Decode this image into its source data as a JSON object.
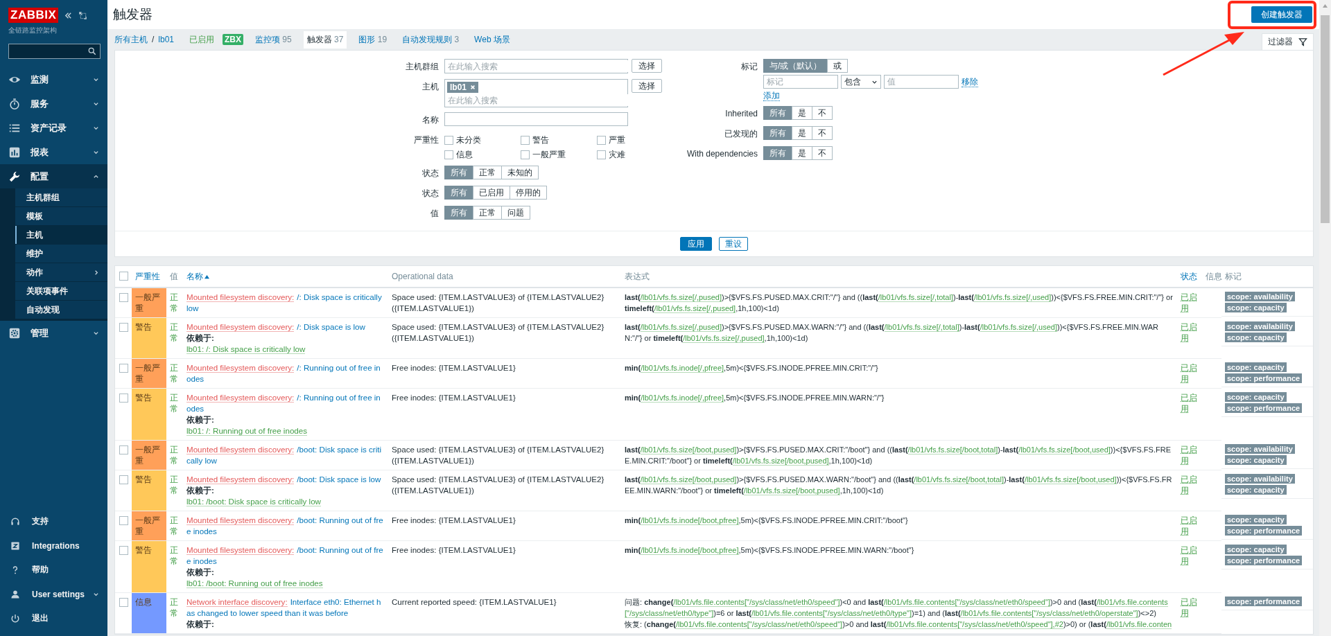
{
  "sidebar": {
    "logo": "ZABBIX",
    "subtitle": "全链路监控架构",
    "menu": [
      {
        "label": "监测",
        "expanded": false
      },
      {
        "label": "服务",
        "expanded": false
      },
      {
        "label": "资产记录",
        "expanded": false
      },
      {
        "label": "报表",
        "expanded": false
      },
      {
        "label": "配置",
        "expanded": true,
        "children": [
          {
            "label": "主机群组",
            "selected": false,
            "submenu": false
          },
          {
            "label": "模板",
            "selected": false,
            "submenu": false
          },
          {
            "label": "主机",
            "selected": true,
            "submenu": false
          },
          {
            "label": "维护",
            "selected": false,
            "submenu": false
          },
          {
            "label": "动作",
            "selected": false,
            "submenu": true
          },
          {
            "label": "关联项事件",
            "selected": false,
            "submenu": false
          },
          {
            "label": "自动发现",
            "selected": false,
            "submenu": false
          }
        ]
      },
      {
        "label": "管理",
        "expanded": false
      }
    ],
    "bottom_menu": [
      {
        "label": "支持",
        "submenu": false
      },
      {
        "label": "Integrations",
        "submenu": false
      },
      {
        "label": "帮助",
        "submenu": false
      },
      {
        "label": "User settings",
        "submenu": true
      },
      {
        "label": "退出",
        "submenu": false
      }
    ]
  },
  "header": {
    "title": "触发器",
    "create_button": "创建触发器"
  },
  "nav": [
    {
      "kind": "link",
      "text": "所有主机"
    },
    {
      "kind": "sep",
      "text": "/"
    },
    {
      "kind": "link",
      "text": "lb01"
    },
    {
      "kind": "status",
      "text": "已启用"
    },
    {
      "kind": "badge",
      "text": "ZBX"
    },
    {
      "kind": "tab",
      "text": "监控项",
      "count": "95",
      "selected": false
    },
    {
      "kind": "tab",
      "text": "触发器",
      "count": "37",
      "selected": true
    },
    {
      "kind": "tab",
      "text": "图形",
      "count": "19",
      "selected": false
    },
    {
      "kind": "tab",
      "text": "自动发现规则",
      "count": "3",
      "selected": false
    },
    {
      "kind": "tab",
      "text": "Web 场景",
      "selected": false
    }
  ],
  "filter": {
    "tab": "过滤器",
    "left": [
      {
        "kind": "multiselect",
        "label": "主机群组",
        "placeholder": "在此输入搜索",
        "button": "选择"
      },
      {
        "kind": "multiselect",
        "label": "主机",
        "chips": [
          "lb01"
        ],
        "placeholder": "在此输入搜索",
        "button": "选择"
      },
      {
        "kind": "text",
        "label": "名称"
      },
      {
        "kind": "checkboxes",
        "label": "严重性",
        "options": [
          {
            "label": "未分类",
            "checked": false
          },
          {
            "label": "警告",
            "checked": false
          },
          {
            "label": "严重",
            "checked": false
          },
          {
            "label": "信息",
            "checked": false
          },
          {
            "label": "一般严重",
            "checked": false
          },
          {
            "label": "灾难",
            "checked": false
          }
        ]
      },
      {
        "kind": "segmented",
        "label": "状态",
        "options": [
          {
            "label": "所有",
            "selected": true
          },
          {
            "label": "正常",
            "selected": false
          },
          {
            "label": "未知的",
            "selected": false
          }
        ]
      },
      {
        "kind": "segmented",
        "label": "状态",
        "options": [
          {
            "label": "所有",
            "selected": true
          },
          {
            "label": "已启用",
            "selected": false
          },
          {
            "label": "停用的",
            "selected": false
          }
        ]
      },
      {
        "kind": "segmented",
        "label": "值",
        "options": [
          {
            "label": "所有",
            "selected": true
          },
          {
            "label": "正常",
            "selected": false
          },
          {
            "label": "问题",
            "selected": false
          }
        ]
      }
    ],
    "right": [
      {
        "kind": "tags",
        "label": "标记",
        "options": [
          {
            "label": "与/或（默认）",
            "selected": true
          },
          {
            "label": "或",
            "selected": false
          }
        ],
        "rows": [
          {
            "tag_placeholder": "标记",
            "operator": "包含",
            "value_placeholder": "值",
            "remove": "移除"
          }
        ],
        "add": "添加"
      },
      {
        "kind": "segmented",
        "label": "Inherited",
        "options": [
          {
            "label": "所有",
            "selected": true
          },
          {
            "label": "是",
            "selected": false
          },
          {
            "label": "不",
            "selected": false
          }
        ]
      },
      {
        "kind": "segmented",
        "label": "已发现的",
        "options": [
          {
            "label": "所有",
            "selected": true
          },
          {
            "label": "是",
            "selected": false
          },
          {
            "label": "不",
            "selected": false
          }
        ]
      },
      {
        "kind": "segmented",
        "label": "With dependencies",
        "options": [
          {
            "label": "所有",
            "selected": true
          },
          {
            "label": "是",
            "selected": false
          },
          {
            "label": "不",
            "selected": false
          }
        ]
      }
    ],
    "apply": "应用",
    "reset": "重设"
  },
  "table": {
    "select_all": {
      "checked": false
    },
    "columns": [
      {
        "label": "严重性",
        "sortable": true,
        "sorted": false
      },
      {
        "label": "值",
        "sortable": false
      },
      {
        "label": "名称",
        "sortable": true,
        "sorted": true
      },
      {
        "label": "Operational data",
        "sortable": false
      },
      {
        "label": "表达式",
        "sortable": false
      },
      {
        "label": "状态",
        "sortable": true,
        "sorted": false
      },
      {
        "label": "信息",
        "sortable": false
      },
      {
        "label": "标记",
        "sortable": false
      }
    ],
    "rows": [
      {
        "checked": false,
        "severity": "一般严重",
        "color": "#ffa059",
        "value": "正常",
        "name_prefix": "Mounted filesystem discovery:",
        "name": "/: Disk space is critically low",
        "opdata": "Space used: {ITEM.LASTVALUE3} of {ITEM.LASTVALUE2} ({ITEM.LASTVALUE1})",
        "expression": [
          [
            {
              "kind": "fn",
              "text": "last("
            },
            {
              "kind": "item",
              "text": "/lb01/vfs.fs.size[/,pused]"
            },
            {
              "kind": "plain",
              "text": ")>{$VFS.FS.PUSED.MAX.CRIT:\"/\"} and (("
            },
            {
              "kind": "fn",
              "text": "last("
            },
            {
              "kind": "item",
              "text": "/lb01/vfs.fs.size[/,total]"
            },
            {
              "kind": "plain",
              "text": ")-"
            },
            {
              "kind": "fn",
              "text": "last("
            },
            {
              "kind": "item",
              "text": "/lb01/vfs.fs.size[/,used]"
            },
            {
              "kind": "plain",
              "text": "))<{$VFS.FS.FREE.MIN.CRIT:\"/\"} or "
            },
            {
              "kind": "fn",
              "text": "timeleft("
            },
            {
              "kind": "item",
              "text": "/lb01/vfs.fs.size[/,pused]"
            },
            {
              "kind": "plain",
              "text": ",1h,100)<1d)"
            }
          ]
        ],
        "status": "已启用",
        "tags": [
          "scope: availability",
          "scope: capacity"
        ]
      },
      {
        "checked": false,
        "severity": "警告",
        "color": "#ffc859",
        "value": "正常",
        "name_prefix": "Mounted filesystem discovery:",
        "name": "/: Disk space is low",
        "depends_label": "依赖于:",
        "depends": "lb01: /: Disk space is critically low",
        "opdata": "Space used: {ITEM.LASTVALUE3} of {ITEM.LASTVALUE2} ({ITEM.LASTVALUE1})",
        "expression": [
          [
            {
              "kind": "fn",
              "text": "last("
            },
            {
              "kind": "item",
              "text": "/lb01/vfs.fs.size[/,pused]"
            },
            {
              "kind": "plain",
              "text": ")>{$VFS.FS.PUSED.MAX.WARN:\"/\"} and (("
            },
            {
              "kind": "fn",
              "text": "last("
            },
            {
              "kind": "item",
              "text": "/lb01/vfs.fs.size[/,total]"
            },
            {
              "kind": "plain",
              "text": ")-"
            },
            {
              "kind": "fn",
              "text": "last("
            },
            {
              "kind": "item",
              "text": "/lb01/vfs.fs.size[/,used]"
            },
            {
              "kind": "plain",
              "text": "))<{$VFS.FS.FREE.MIN.WARN:\"/\"} or "
            },
            {
              "kind": "fn",
              "text": "timeleft("
            },
            {
              "kind": "item",
              "text": "/lb01/vfs.fs.size[/,pused]"
            },
            {
              "kind": "plain",
              "text": ",1h,100)<1d)"
            }
          ]
        ],
        "status": "已启用",
        "tags": [
          "scope: availability",
          "scope: capacity"
        ]
      },
      {
        "checked": false,
        "severity": "一般严重",
        "color": "#ffa059",
        "value": "正常",
        "name_prefix": "Mounted filesystem discovery:",
        "name": "/: Running out of free inodes",
        "opdata": "Free inodes: {ITEM.LASTVALUE1}",
        "expression": [
          [
            {
              "kind": "fn",
              "text": "min("
            },
            {
              "kind": "item",
              "text": "/lb01/vfs.fs.inode[/,pfree]"
            },
            {
              "kind": "plain",
              "text": ",5m)<{$VFS.FS.INODE.PFREE.MIN.CRIT:\"/\"}"
            }
          ]
        ],
        "status": "已启用",
        "tags": [
          "scope: capacity",
          "scope: performance"
        ]
      },
      {
        "checked": false,
        "severity": "警告",
        "color": "#ffc859",
        "value": "正常",
        "name_prefix": "Mounted filesystem discovery:",
        "name": "/: Running out of free inodes",
        "depends_label": "依赖于:",
        "depends": "lb01: /: Running out of free inodes",
        "opdata": "Free inodes: {ITEM.LASTVALUE1}",
        "expression": [
          [
            {
              "kind": "fn",
              "text": "min("
            },
            {
              "kind": "item",
              "text": "/lb01/vfs.fs.inode[/,pfree]"
            },
            {
              "kind": "plain",
              "text": ",5m)<{$VFS.FS.INODE.PFREE.MIN.WARN:\"/\"}"
            }
          ]
        ],
        "status": "已启用",
        "tags": [
          "scope: capacity",
          "scope: performance"
        ]
      },
      {
        "checked": false,
        "severity": "一般严重",
        "color": "#ffa059",
        "value": "正常",
        "name_prefix": "Mounted filesystem discovery:",
        "name": "/boot: Disk space is critically low",
        "opdata": "Space used: {ITEM.LASTVALUE3} of {ITEM.LASTVALUE2} ({ITEM.LASTVALUE1})",
        "expression": [
          [
            {
              "kind": "fn",
              "text": "last("
            },
            {
              "kind": "item",
              "text": "/lb01/vfs.fs.size[/boot,pused]"
            },
            {
              "kind": "plain",
              "text": ")>{$VFS.FS.PUSED.MAX.CRIT:\"/boot\"} and (("
            },
            {
              "kind": "fn",
              "text": "last("
            },
            {
              "kind": "item",
              "text": "/lb01/vfs.fs.size[/boot,total]"
            },
            {
              "kind": "plain",
              "text": ")-"
            },
            {
              "kind": "fn",
              "text": "last("
            },
            {
              "kind": "item",
              "text": "/lb01/vfs.fs.size[/boot,used]"
            },
            {
              "kind": "plain",
              "text": "))<{$VFS.FS.FREE.MIN.CRIT:\"/boot\"} or "
            },
            {
              "kind": "fn",
              "text": "timeleft("
            },
            {
              "kind": "item",
              "text": "/lb01/vfs.fs.size[/boot,pused]"
            },
            {
              "kind": "plain",
              "text": ",1h,100)<1d)"
            }
          ]
        ],
        "status": "已启用",
        "tags": [
          "scope: availability",
          "scope: capacity"
        ]
      },
      {
        "checked": false,
        "severity": "警告",
        "color": "#ffc859",
        "value": "正常",
        "name_prefix": "Mounted filesystem discovery:",
        "name": "/boot: Disk space is low",
        "depends_label": "依赖于:",
        "depends": "lb01: /boot: Disk space is critically low",
        "opdata": "Space used: {ITEM.LASTVALUE3} of {ITEM.LASTVALUE2} ({ITEM.LASTVALUE1})",
        "expression": [
          [
            {
              "kind": "fn",
              "text": "last("
            },
            {
              "kind": "item",
              "text": "/lb01/vfs.fs.size[/boot,pused]"
            },
            {
              "kind": "plain",
              "text": ")>{$VFS.FS.PUSED.MAX.WARN:\"/boot\"} and (("
            },
            {
              "kind": "fn",
              "text": "last("
            },
            {
              "kind": "item",
              "text": "/lb01/vfs.fs.size[/boot,total]"
            },
            {
              "kind": "plain",
              "text": ")-"
            },
            {
              "kind": "fn",
              "text": "last("
            },
            {
              "kind": "item",
              "text": "/lb01/vfs.fs.size[/boot,used]"
            },
            {
              "kind": "plain",
              "text": "))<{$VFS.FS.FREE.MIN.WARN:\"/boot\"} or "
            },
            {
              "kind": "fn",
              "text": "timeleft("
            },
            {
              "kind": "item",
              "text": "/lb01/vfs.fs.size[/boot,pused]"
            },
            {
              "kind": "plain",
              "text": ",1h,100)<1d)"
            }
          ]
        ],
        "status": "已启用",
        "tags": [
          "scope: availability",
          "scope: capacity"
        ]
      },
      {
        "checked": false,
        "severity": "一般严重",
        "color": "#ffa059",
        "value": "正常",
        "name_prefix": "Mounted filesystem discovery:",
        "name": "/boot: Running out of free inodes",
        "opdata": "Free inodes: {ITEM.LASTVALUE1}",
        "expression": [
          [
            {
              "kind": "fn",
              "text": "min("
            },
            {
              "kind": "item",
              "text": "/lb01/vfs.fs.inode[/boot,pfree]"
            },
            {
              "kind": "plain",
              "text": ",5m)<{$VFS.FS.INODE.PFREE.MIN.CRIT:\"/boot\"}"
            }
          ]
        ],
        "status": "已启用",
        "tags": [
          "scope: capacity",
          "scope: performance"
        ]
      },
      {
        "checked": false,
        "severity": "警告",
        "color": "#ffc859",
        "value": "正常",
        "name_prefix": "Mounted filesystem discovery:",
        "name": "/boot: Running out of free inodes",
        "depends_label": "依赖于:",
        "depends": "lb01: /boot: Running out of free inodes",
        "opdata": "Free inodes: {ITEM.LASTVALUE1}",
        "expression": [
          [
            {
              "kind": "fn",
              "text": "min("
            },
            {
              "kind": "item",
              "text": "/lb01/vfs.fs.inode[/boot,pfree]"
            },
            {
              "kind": "plain",
              "text": ",5m)<{$VFS.FS.INODE.PFREE.MIN.WARN:\"/boot\"}"
            }
          ]
        ],
        "status": "已启用",
        "tags": [
          "scope: capacity",
          "scope: performance"
        ]
      },
      {
        "checked": false,
        "severity": "信息",
        "color": "#7499ff",
        "value": "正常",
        "name_prefix": "Network interface discovery:",
        "name": "Interface eth0: Ethernet has changed to lower speed than it was before",
        "depends_label": "依赖于:",
        "opdata": "Current reported speed: {ITEM.LASTVALUE1}",
        "expression": [
          [
            {
              "kind": "plain",
              "text": "问题: "
            },
            {
              "kind": "fn",
              "text": "change("
            },
            {
              "kind": "item",
              "text": "/lb01/vfs.file.contents[\"/sys/class/net/eth0/speed\"]"
            },
            {
              "kind": "plain",
              "text": ")<0 and "
            },
            {
              "kind": "fn",
              "text": "last("
            },
            {
              "kind": "item",
              "text": "/lb01/vfs.file.contents[\"/sys/class/net/eth0/speed\"]"
            },
            {
              "kind": "plain",
              "text": ")>0 and ("
            },
            {
              "kind": "fn",
              "text": "last("
            },
            {
              "kind": "item",
              "text": "/lb01/vfs.file.contents[\"/sys/class/net/eth0/type\"]"
            },
            {
              "kind": "plain",
              "text": ")=6 or "
            },
            {
              "kind": "fn",
              "text": "last("
            },
            {
              "kind": "item",
              "text": "/lb01/vfs.file.contents[\"/sys/class/net/eth0/type\"]"
            },
            {
              "kind": "plain",
              "text": ")=1) and ("
            },
            {
              "kind": "fn",
              "text": "last("
            },
            {
              "kind": "item",
              "text": "/lb01/vfs.file.contents[\"/sys/class/net/eth0/operstate\"]"
            },
            {
              "kind": "plain",
              "text": ")<>2)"
            }
          ],
          [
            {
              "kind": "plain",
              "text": "恢复: ("
            },
            {
              "kind": "fn",
              "text": "change("
            },
            {
              "kind": "item",
              "text": "/lb01/vfs.file.contents[\"/sys/class/net/eth0/speed\"]"
            },
            {
              "kind": "plain",
              "text": ")>0 and "
            },
            {
              "kind": "fn",
              "text": "last("
            },
            {
              "kind": "item",
              "text": "/lb01/vfs.file.contents[\"/sys/class/net/eth0/speed\"],#2"
            },
            {
              "kind": "plain",
              "text": ")>0) or ("
            },
            {
              "kind": "fn",
              "text": "last("
            },
            {
              "kind": "item",
              "text": "/lb01/vfs.file.conten"
            }
          ]
        ],
        "status": "已启用",
        "tags": [
          "scope: performance"
        ]
      }
    ]
  }
}
